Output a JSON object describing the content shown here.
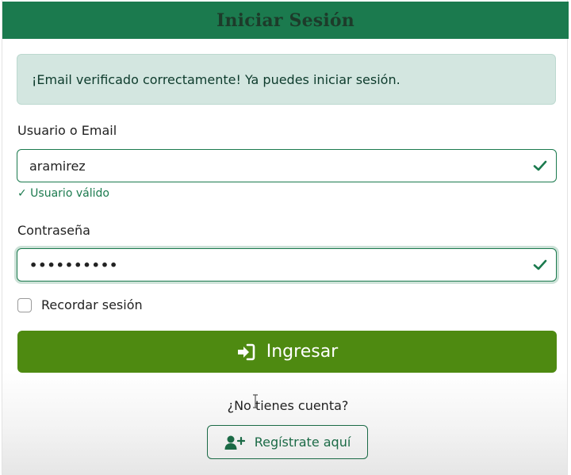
{
  "header": {
    "title": "Iniciar Sesión"
  },
  "alert": {
    "message": "¡Email verificado correctamente! Ya puedes iniciar sesión."
  },
  "username": {
    "label": "Usuario o Email",
    "value": "aramirez",
    "feedback": "✓ Usuario válido"
  },
  "password": {
    "label": "Contraseña",
    "masked_value": "••••••••••"
  },
  "remember": {
    "label": "Recordar sesión",
    "checked": false
  },
  "login_button": {
    "label": "Ingresar",
    "icon": "sign-in-icon"
  },
  "register": {
    "prompt": "¿No tienes cuenta?",
    "button_label": "Regístrate aquí",
    "icon": "user-plus-icon"
  },
  "colors": {
    "header_bg": "#1b7a4e",
    "alert_bg": "#d3e6e0",
    "primary_button": "#4e8a11",
    "valid_green": "#1b7a4e"
  }
}
